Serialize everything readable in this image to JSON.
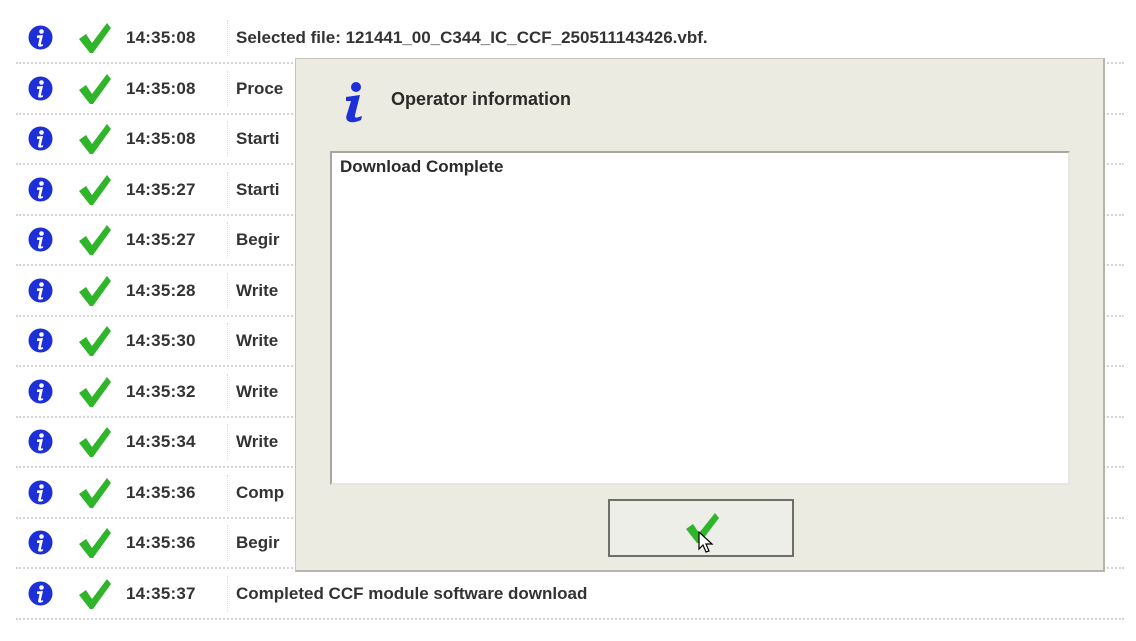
{
  "log_entries": [
    {
      "time": "14:35:08",
      "message": "Selected file: 121441_00_C344_IC_CCF_250511143426.vbf.",
      "status_icon": "info-icon",
      "result_icon": "check-icon"
    },
    {
      "time": "14:35:08",
      "message": "Proce",
      "status_icon": "info-icon",
      "result_icon": "check-icon"
    },
    {
      "time": "14:35:08",
      "message": "Starti",
      "status_icon": "info-icon",
      "result_icon": "check-icon"
    },
    {
      "time": "14:35:27",
      "message": "Starti",
      "status_icon": "info-icon",
      "result_icon": "check-icon"
    },
    {
      "time": "14:35:27",
      "message": "Begir",
      "status_icon": "info-icon",
      "result_icon": "check-icon"
    },
    {
      "time": "14:35:28",
      "message": "Write",
      "status_icon": "info-icon",
      "result_icon": "check-icon"
    },
    {
      "time": "14:35:30",
      "message": "Write",
      "status_icon": "info-icon",
      "result_icon": "check-icon"
    },
    {
      "time": "14:35:32",
      "message": "Write",
      "status_icon": "info-icon",
      "result_icon": "check-icon"
    },
    {
      "time": "14:35:34",
      "message": "Write",
      "status_icon": "info-icon",
      "result_icon": "check-icon"
    },
    {
      "time": "14:35:36",
      "message": "Comp",
      "status_icon": "info-icon",
      "result_icon": "check-icon"
    },
    {
      "time": "14:35:36",
      "message": "Begir",
      "status_icon": "info-icon",
      "result_icon": "check-icon"
    },
    {
      "time": "14:35:37",
      "message": "Completed CCF module software download",
      "status_icon": "info-icon",
      "result_icon": "check-icon"
    }
  ],
  "dialog": {
    "title": "Operator information",
    "message": "Download Complete",
    "ok_button_icon": "check-icon"
  },
  "colors": {
    "info_blue": "#1d2fd6",
    "check_green": "#2fb52a",
    "dialog_bg": "#ecebe1",
    "text": "#333333"
  }
}
